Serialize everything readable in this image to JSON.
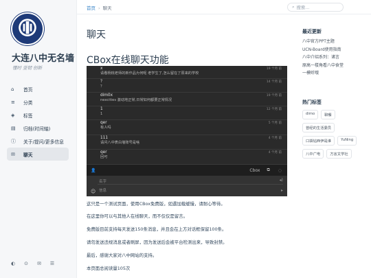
{
  "site": {
    "title": "大连八中无名墙",
    "subtitle": "懂时 坚韧 创新",
    "logo_text": "大连市第八中学"
  },
  "nav": [
    {
      "icon": "home-icon",
      "glyph": "⌂",
      "label": "首页",
      "active": false
    },
    {
      "icon": "menu-icon",
      "glyph": "≡",
      "label": "分类",
      "active": false
    },
    {
      "icon": "tag-icon",
      "glyph": "◈",
      "label": "标签",
      "active": false
    },
    {
      "icon": "archive-icon",
      "glyph": "▤",
      "label": "归档(时间轴)",
      "active": false
    },
    {
      "icon": "info-icon",
      "glyph": "ⓘ",
      "label": "关于/提问/更多信息",
      "active": false
    },
    {
      "icon": "chat-icon",
      "glyph": "✉",
      "label": "聊天",
      "active": true
    }
  ],
  "breadcrumb": {
    "home": "首页",
    "current": "聊天"
  },
  "search": {
    "placeholder": "搜索..."
  },
  "page_title": "聊天",
  "section_title": "CBox在线聊天功能",
  "chat": {
    "messages": [
      {
        "name": "x",
        "text": "请看杨桃老师的新作品为何呢 老学生了,怎么留在了原来的学校",
        "time": "19 个月 前"
      },
      {
        "name": "？",
        "text": "？",
        "time": "14 个月 前"
      },
      {
        "name": "dim0x",
        "text": "nexcities 激动地正常,日常如何都要正常情况",
        "time": "19 个月 前"
      },
      {
        "name": "1",
        "text": "1",
        "time": "12 个月 前"
      },
      {
        "name": "qer",
        "text": "有人吗",
        "time": "5 个月 前"
      },
      {
        "name": "111",
        "text": "请问八中表白墙账号是啥",
        "time": "4 个月 前"
      },
      {
        "name": "qer",
        "text": "回可",
        "time": "4 个月 前"
      }
    ],
    "bar_label": "Cbox",
    "name_placeholder": "名字",
    "message_placeholder": "信息"
  },
  "paragraphs": [
    "这只是一个测试页面，使用CBox免费版，如遇加载缓慢，请耐心等待。",
    "在这里你可以与其他人在线聊天，而不仅仅是留言。",
    "免费版目前支持每天发送150条消息，并且会在上方对话框保留100条。",
    "请勿发送违规消息或者刷屏，因为发送后会被平台检测出来，导致封禁。",
    "最后，感谢大家对八中网站的支持。",
    "本页面总阅读量105次"
  ],
  "recent": {
    "heading": "最近更新",
    "items": [
      "八中官方PPT主题",
      "UCN-Board使用指南",
      "八中介绍系列：诸言",
      "原高一楼角看八中食堂",
      "一模听哦"
    ]
  },
  "tags": {
    "heading": "热门标签",
    "items": [
      "dimo",
      "聊餐",
      "曾经的生活委员",
      "口袋钻西伊是谁",
      "YuNing",
      "八中广电",
      "方言文学社"
    ]
  }
}
